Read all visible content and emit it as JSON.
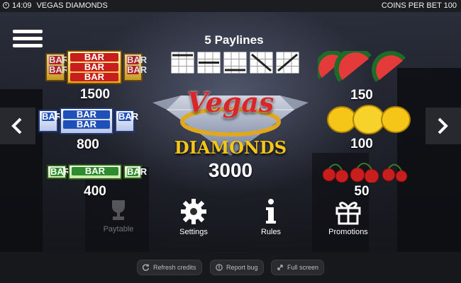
{
  "status_bar": {
    "time": "14:09",
    "game_title": "VEGAS DIAMONDS",
    "coins_per_bet": "COINS PER BET 100"
  },
  "paytable": {
    "paylines_title": "5 Paylines",
    "logo_line1": "Vegas",
    "logo_line2": "DIAMONDS",
    "logo_value": "3000",
    "left_column": [
      {
        "symbol": "triple-bar-red",
        "value": "1500"
      },
      {
        "symbol": "double-bar-blue",
        "value": "800"
      },
      {
        "symbol": "single-bar-green",
        "value": "400"
      }
    ],
    "right_column": [
      {
        "symbol": "watermelon",
        "value": "150"
      },
      {
        "symbol": "lemon",
        "value": "100"
      },
      {
        "symbol": "cherry",
        "value": "50"
      }
    ],
    "bar_text": "BAR"
  },
  "menu": {
    "paytable_label": "Paytable",
    "settings_label": "Settings",
    "rules_label": "Rules",
    "promotions_label": "Promotions"
  },
  "footer": {
    "refresh_label": "Refresh credits",
    "report_label": "Report bug",
    "fullscreen_label": "Full screen"
  },
  "colors": {
    "accent_gold": "#f5c518",
    "bar_red": "#c81e1e",
    "bar_blue": "#1f4fb8",
    "bar_green": "#2e8b2e"
  }
}
